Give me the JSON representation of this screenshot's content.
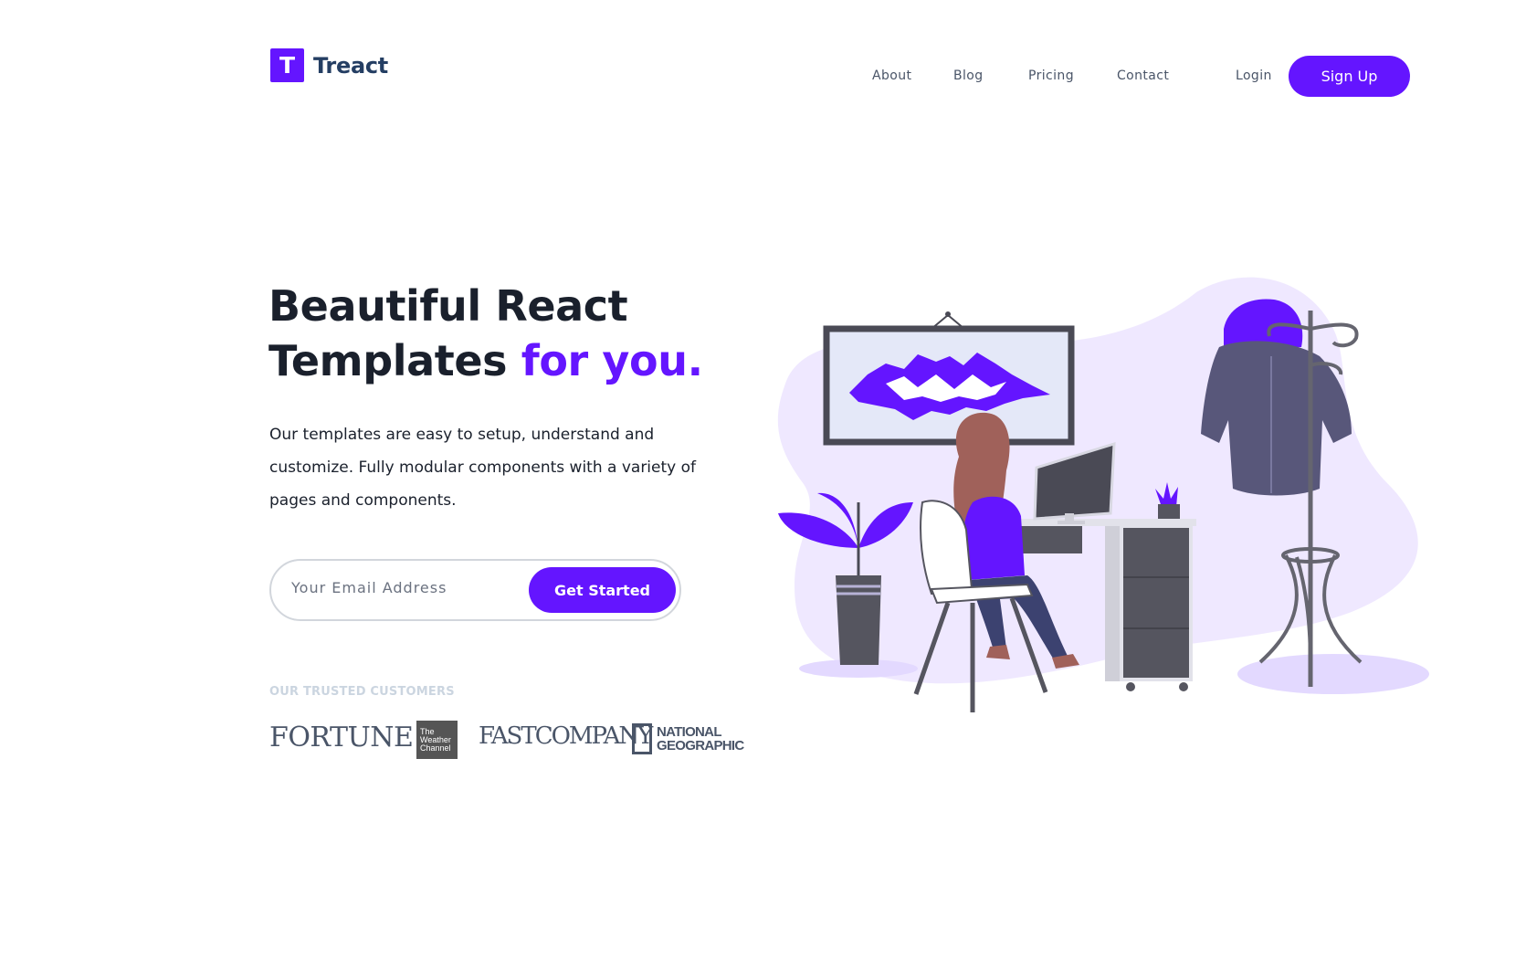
{
  "header": {
    "logo_letter": "T",
    "brand": "Treact",
    "nav": [
      "About",
      "Blog",
      "Pricing",
      "Contact"
    ],
    "login": "Login",
    "signup": "Sign Up"
  },
  "hero": {
    "title_line1": "Beautiful React",
    "title_line2_plain": "Templates ",
    "title_line2_accent": "for you.",
    "description": "Our templates are easy to setup, understand and customize. Fully modular components with a variety of pages and components.",
    "email_placeholder": "Your Email Address",
    "cta": "Get Started"
  },
  "customers": {
    "heading": "OUR TRUSTED CUSTOMERS",
    "logos": [
      "FORTUNE",
      "The Weather Channel",
      "FAST COMPANY",
      "NATIONAL GEOGRAPHIC"
    ],
    "fortune": "FORTUNE",
    "weather": [
      "The",
      "Weather",
      "Channel"
    ],
    "fastco": "FASTCOMPANY",
    "natgeo": [
      "NATIONAL",
      "GEOGRAPHIC"
    ]
  },
  "colors": {
    "accent": "#6415ff",
    "heading": "#1a202c",
    "logo_text": "#243e63",
    "muted": "#cbd5e0",
    "illustration_bg": "#efe8ff"
  },
  "icons": {
    "logo": "T-square-logo",
    "illustration": "woman-working-at-desk"
  }
}
